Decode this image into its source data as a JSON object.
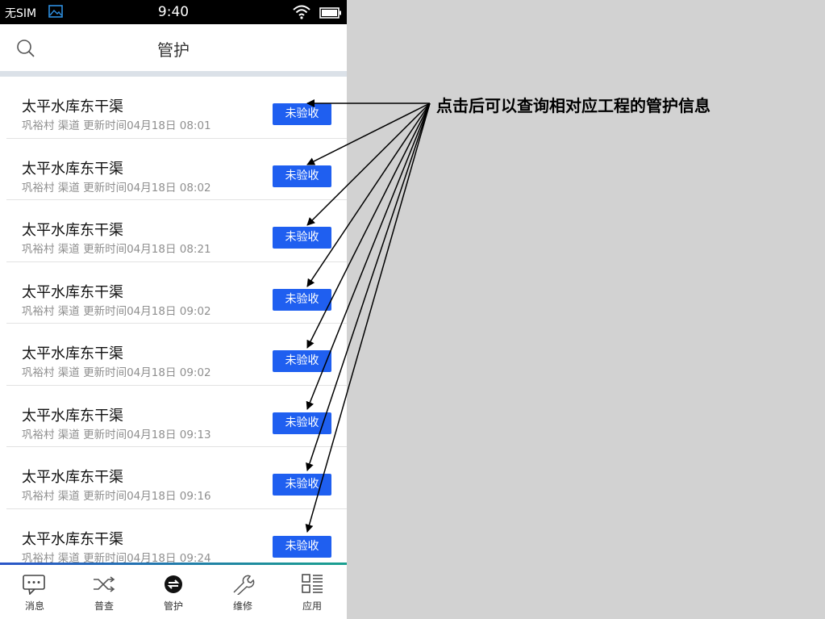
{
  "status_bar": {
    "carrier": "无SIM",
    "time": "9:40"
  },
  "header": {
    "title": "管护"
  },
  "list": [
    {
      "name": "太平水库东干渠",
      "subtitle": "巩裕村 渠道 更新时间04月18日 08:01",
      "badge": "未验收"
    },
    {
      "name": "太平水库东干渠",
      "subtitle": "巩裕村 渠道 更新时间04月18日 08:02",
      "badge": "未验收"
    },
    {
      "name": "太平水库东干渠",
      "subtitle": "巩裕村 渠道 更新时间04月18日 08:21",
      "badge": "未验收"
    },
    {
      "name": "太平水库东干渠",
      "subtitle": "巩裕村 渠道 更新时间04月18日 09:02",
      "badge": "未验收"
    },
    {
      "name": "太平水库东干渠",
      "subtitle": "巩裕村 渠道 更新时间04月18日 09:02",
      "badge": "未验收"
    },
    {
      "name": "太平水库东干渠",
      "subtitle": "巩裕村 渠道 更新时间04月18日 09:13",
      "badge": "未验收"
    },
    {
      "name": "太平水库东干渠",
      "subtitle": "巩裕村 渠道 更新时间04月18日 09:16",
      "badge": "未验收"
    },
    {
      "name": "太平水库东干渠",
      "subtitle": "巩裕村 渠道 更新时间04月18日 09:24",
      "badge": "未验收"
    }
  ],
  "tabbar": {
    "tabs": [
      {
        "label": "消息",
        "icon": "message-icon"
      },
      {
        "label": "普查",
        "icon": "shuffle-icon"
      },
      {
        "label": "管护",
        "icon": "manage-icon",
        "active": true
      },
      {
        "label": "维修",
        "icon": "wrench-icon"
      },
      {
        "label": "应用",
        "icon": "apps-grid-icon"
      }
    ]
  },
  "annotation": {
    "text": "点击后可以查询相对应工程的管护信息"
  },
  "colors": {
    "badge": "#1f5ff0",
    "tab_accent_start": "#2a55c8",
    "tab_accent_end": "#1aa08f",
    "background": "#d2d2d2"
  }
}
